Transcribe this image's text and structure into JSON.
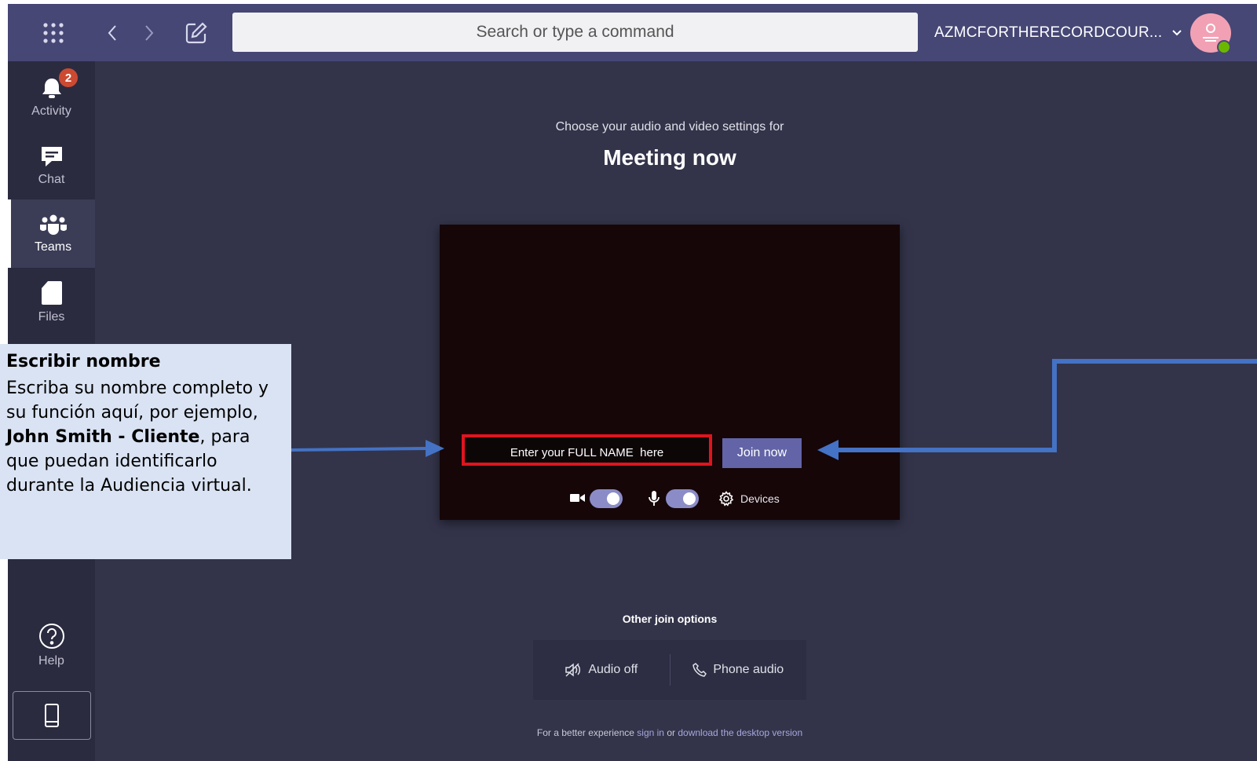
{
  "topbar": {
    "search_placeholder": "Search or type a command",
    "tenant_name": "AZMCFORTHERECORDCOUR...",
    "icons": [
      "apps-grid-icon",
      "back-icon",
      "forward-icon",
      "compose-icon",
      "chevron-down-icon",
      "avatar-icon"
    ]
  },
  "rail": {
    "activity_label": "Activity",
    "activity_badge": "2",
    "chat_label": "Chat",
    "teams_label": "Teams",
    "files_label": "Files",
    "help_label": "Help",
    "active": "Teams"
  },
  "main": {
    "subtitle": "Choose your audio and video settings for",
    "title": "Meeting now",
    "name_placeholder": "Enter your FULL NAME  here",
    "join_label": "Join now",
    "devices_label": "Devices",
    "camera_on": true,
    "mic_on": true,
    "other_options_label": "Other join options",
    "audio_off_label": "Audio off",
    "phone_audio_label": "Phone audio",
    "footer_prefix": "For a better experience",
    "footer_signin": "sign in",
    "footer_or": "or",
    "footer_download": "download the desktop version"
  },
  "callout": {
    "title": "Escribir nombre",
    "body_1": "Escriba su nombre completo y su función aquí, por ejemplo, ",
    "body_bold": "John Smith - Cliente",
    "body_2": ", para que puedan identificarlo durante la Audiencia virtual."
  },
  "colors": {
    "topbar": "#464775",
    "rail": "#2b2b40",
    "background": "#33344a",
    "accent": "#6264a7",
    "highlight": "#e0141e",
    "callout_bg": "#dae3f3",
    "arrow": "#4472c4"
  }
}
